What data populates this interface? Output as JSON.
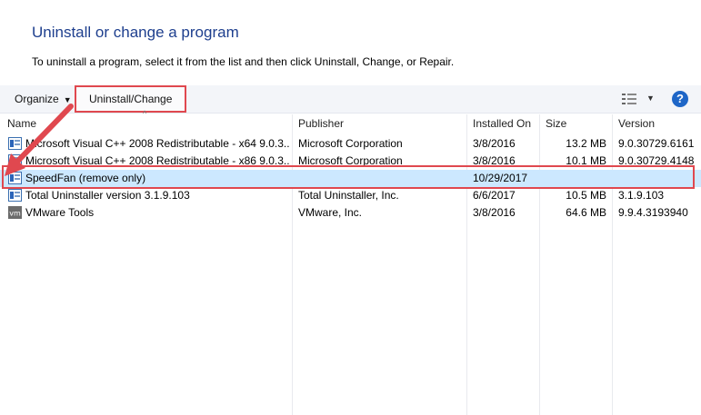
{
  "page": {
    "title": "Uninstall or change a program",
    "instructions": "To uninstall a program, select it from the list and then click Uninstall, Change, or Repair."
  },
  "toolbar": {
    "organize_label": "Organize",
    "uninstall_label": "Uninstall/Change",
    "view_icon": "view-details-icon",
    "help_icon": "help-icon",
    "help_glyph": "?"
  },
  "columns": {
    "name": "Name",
    "publisher": "Publisher",
    "installed_on": "Installed On",
    "size": "Size",
    "version": "Version"
  },
  "programs": [
    {
      "name": "Microsoft Visual C++ 2008 Redistributable - x64 9.0.3...",
      "publisher": "Microsoft Corporation",
      "installed_on": "3/8/2016",
      "size": "13.2 MB",
      "version": "9.0.30729.6161"
    },
    {
      "name": "Microsoft Visual C++ 2008 Redistributable - x86 9.0.3...",
      "publisher": "Microsoft Corporation",
      "installed_on": "3/8/2016",
      "size": "10.1 MB",
      "version": "9.0.30729.4148"
    },
    {
      "name": "SpeedFan (remove only)",
      "publisher": "",
      "installed_on": "10/29/2017",
      "size": "",
      "version": ""
    },
    {
      "name": "Total Uninstaller version 3.1.9.103",
      "publisher": "Total Uninstaller, Inc.",
      "installed_on": "6/6/2017",
      "size": "10.5 MB",
      "version": "3.1.9.103"
    },
    {
      "name": "VMware Tools",
      "publisher": "VMware, Inc.",
      "installed_on": "3/8/2016",
      "size": "64.6 MB",
      "version": "9.9.4.3193940"
    }
  ],
  "selected_index": 2,
  "colors": {
    "accent_title": "#1e3f8e",
    "annotation_red": "#e0484f",
    "selection": "#cce8ff"
  }
}
